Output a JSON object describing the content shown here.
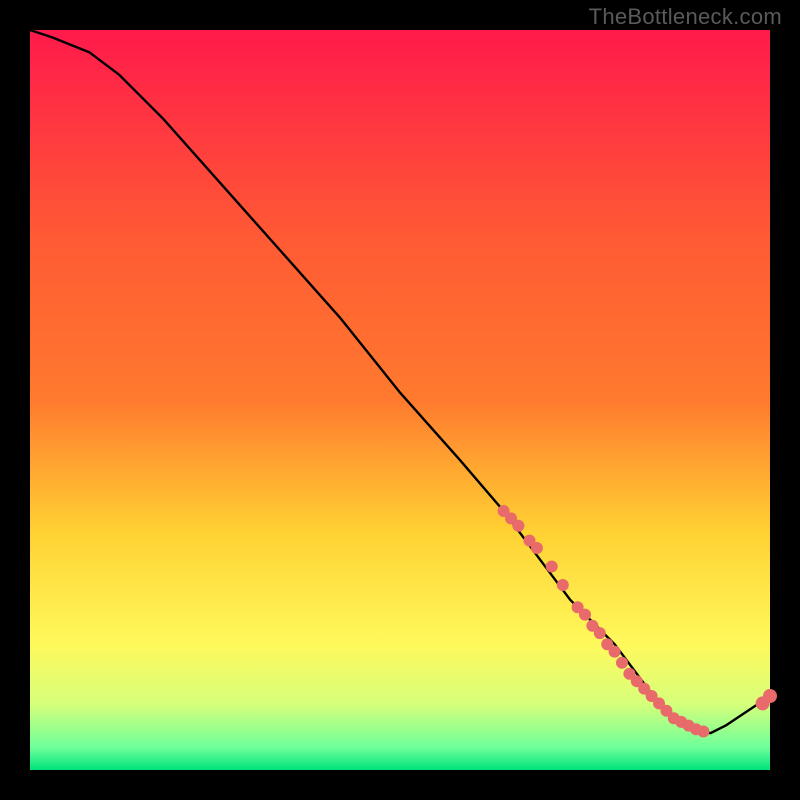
{
  "watermark": "TheBottleneck.com",
  "chart_data": {
    "type": "line",
    "title": "",
    "xlabel": "",
    "ylabel": "",
    "xlim": [
      0,
      100
    ],
    "ylim": [
      0,
      100
    ],
    "gradient_colors": {
      "top": "#ff1a4b",
      "mid1": "#ff7a2e",
      "mid2": "#ffd233",
      "mid3": "#fff95c",
      "low": "#d7ff7a",
      "bottom": "#00e37a"
    },
    "series": [
      {
        "name": "curve",
        "x": [
          0,
          3,
          8,
          12,
          18,
          26,
          34,
          42,
          50,
          58,
          64,
          70,
          73,
          76,
          79,
          82,
          85,
          88,
          90,
          92,
          94,
          100
        ],
        "y": [
          100,
          99,
          97,
          94,
          88,
          79,
          70,
          61,
          51,
          42,
          35,
          27,
          23,
          20,
          17,
          13,
          9,
          6,
          5,
          5,
          6,
          10
        ]
      }
    ],
    "points": {
      "name": "markers",
      "color": "#e86a6a",
      "radius_small": 6,
      "radius_large": 7,
      "x": [
        64,
        65,
        66,
        67.5,
        68.5,
        70.5,
        72,
        74,
        75,
        76,
        77,
        78,
        79,
        80,
        81,
        82,
        83,
        84,
        85,
        86,
        87,
        88,
        89,
        90,
        91,
        99,
        100
      ],
      "y": [
        35,
        34,
        33,
        31,
        30,
        27.5,
        25,
        22,
        21,
        19.5,
        18.5,
        17,
        16,
        14.5,
        13,
        12,
        11,
        10,
        9,
        8,
        7,
        6.5,
        6,
        5.5,
        5.2,
        9,
        10
      ]
    }
  }
}
